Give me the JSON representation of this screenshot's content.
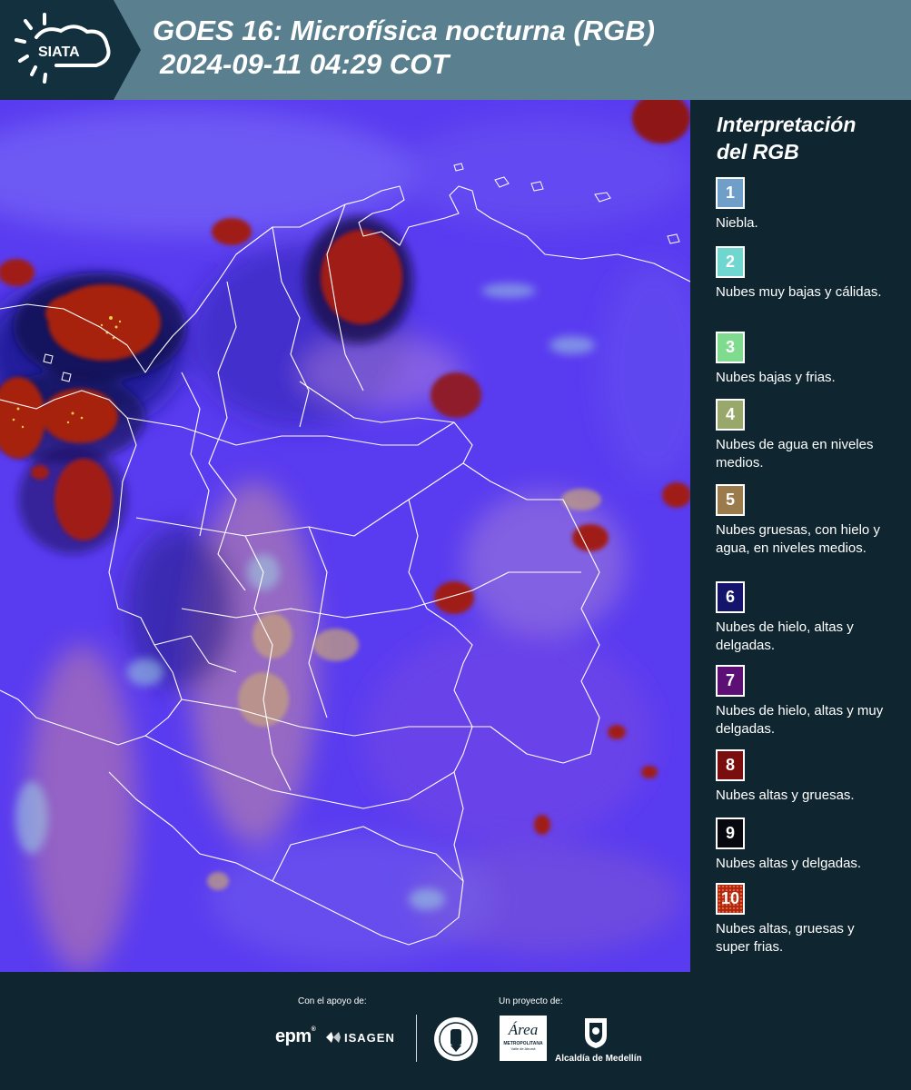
{
  "header": {
    "logo_text": "SIATA",
    "title_line1": "GOES 16: Microfísica nocturna (RGB)",
    "title_line2": "2024-09-11 04:29 COT"
  },
  "legend": {
    "heading_line1": "Interpretación",
    "heading_line2": "del RGB",
    "items": [
      {
        "number": "1",
        "label": "Niebla.",
        "color": "#6f9fc8"
      },
      {
        "number": "2",
        "label": "Nubes muy bajas y cálidas.",
        "color": "#6fd6d0"
      },
      {
        "number": "3",
        "label": "Nubes bajas y frias.",
        "color": "#7fdb8e"
      },
      {
        "number": "4",
        "label": "Nubes de agua en niveles medios.",
        "color": "#97a86a"
      },
      {
        "number": "5",
        "label": "Nubes gruesas, con hielo y agua, en niveles medios.",
        "color": "#9b7a4c"
      },
      {
        "number": "6",
        "label": "Nubes de hielo, altas y delgadas.",
        "color": "#15146c"
      },
      {
        "number": "7",
        "label": "Nubes de hielo, altas y muy delgadas.",
        "color": "#5e0f76"
      },
      {
        "number": "8",
        "label": "Nubes altas y gruesas.",
        "color": "#7a0d0d"
      },
      {
        "number": "9",
        "label": "Nubes altas y delgadas.",
        "color": "#07080d"
      },
      {
        "number": "10",
        "label": "Nubes altas, gruesas y super frias.",
        "color": "#b0250e"
      }
    ]
  },
  "footer": {
    "support_label": "Con el apoyo de:",
    "project_label": "Un proyecto de:",
    "epm": "epm",
    "isagen": "ISAGEN",
    "area_top": "Área",
    "area_mid": "METROPOLITANA",
    "area_bottom": "Valle de Aburrá",
    "alcaldia": "Alcaldía de Medellín"
  }
}
